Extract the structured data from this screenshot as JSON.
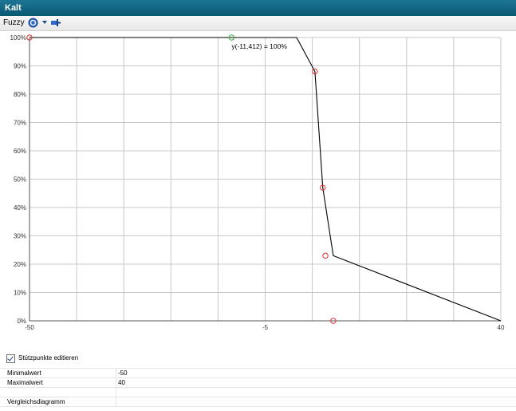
{
  "window": {
    "title": "Kalt"
  },
  "toolbar": {
    "menu_label": "Fuzzy",
    "icons": [
      "help-icon",
      "dropdown-arrow-icon",
      "pin-icon"
    ]
  },
  "chart_data": {
    "type": "line",
    "x": [
      -50,
      -11.412,
      1,
      4.5,
      6,
      8,
      40
    ],
    "y": [
      100,
      100,
      100,
      88,
      47,
      23,
      0
    ],
    "x_ticks": [
      "-50",
      "-5",
      "40"
    ],
    "y_ticks": [
      "0%",
      "10%",
      "20%",
      "30%",
      "40%",
      "50%",
      "60%",
      "70%",
      "80%",
      "90%",
      "100%"
    ],
    "xlim": [
      -50,
      40
    ],
    "ylim": [
      0,
      100
    ],
    "grid": true,
    "control_points": [
      {
        "x": -50,
        "y": 100
      },
      {
        "x": 4.5,
        "y": 88
      },
      {
        "x": 6,
        "y": 47
      },
      {
        "x": 6.5,
        "y": 23
      },
      {
        "x": 8,
        "y": 0
      }
    ],
    "selected_point": {
      "x": -11.412,
      "y": 100
    },
    "annotation": "y(-11,412) = 100%",
    "colors": {
      "line": "#000000",
      "point": "#e03030",
      "selected": "#3cb043",
      "grid": "#c8c8c8"
    }
  },
  "options": {
    "edit_points_label": "Stützpunkte editieren",
    "edit_points_checked": true
  },
  "properties": [
    {
      "name": "Minimalwert",
      "value": "-50"
    },
    {
      "name": "Maximalwert",
      "value": "40"
    },
    {
      "name": "",
      "value": ""
    },
    {
      "name": "Vergleichsdiagramm",
      "value": ""
    }
  ]
}
